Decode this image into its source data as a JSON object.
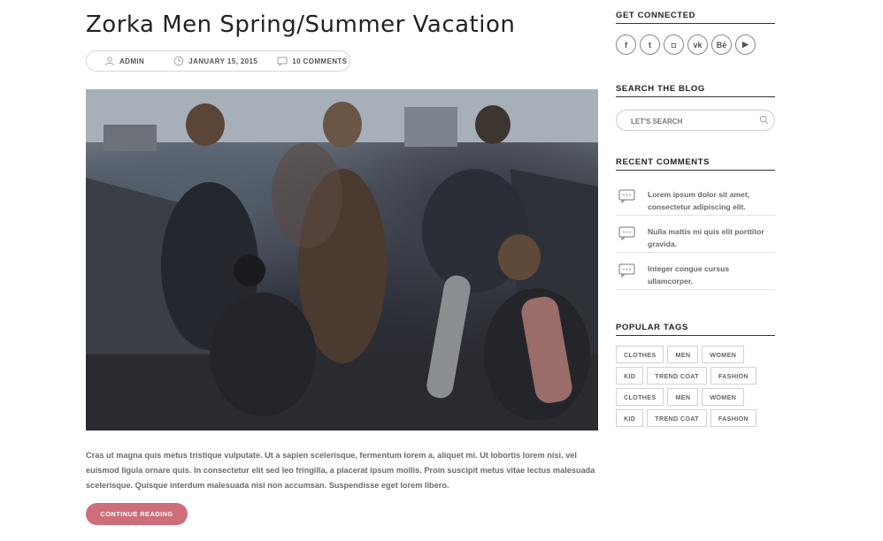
{
  "post": {
    "title": "Zorka Men Spring/Summer Vacation",
    "meta": {
      "author": "ADMIN",
      "date": "JANUARY 15, 2015",
      "comments": "10 COMMENTS"
    },
    "excerpt": "Cras ut magna quis metus tristique vulputate. Ut a sapien scelerisque, fermentum lorem a, aliquet mi. Ut lobortis lorem nisi, vel euismod ligula ornare quis. In consectetur elit sed leo fringilla, a placerat ipsum mollis. Proin suscipit metus vitae lectus malesuada scelerisque. Quisque interdum malesuada nisi non accumsan. Suspendisse eget lorem libero.",
    "continue_label": "CONTINUE READING",
    "image_icon": "photo-icon"
  },
  "sidebar": {
    "connected_title": "GET CONNECTED",
    "social": [
      {
        "icon": "facebook-icon",
        "glyph": "f"
      },
      {
        "icon": "twitter-icon",
        "glyph": "t"
      },
      {
        "icon": "instagram-icon",
        "glyph": "◘"
      },
      {
        "icon": "vk-icon",
        "glyph": "vk"
      },
      {
        "icon": "behance-icon",
        "glyph": "Bē"
      },
      {
        "icon": "youtube-icon",
        "glyph": "▶"
      }
    ],
    "search_title": "SEARCH THE BLOG",
    "search_placeholder": "LET'S SEARCH",
    "recent_title": "RECENT COMMENTS",
    "recent": [
      {
        "text": "Lorem ipsum dolor sit amet, consectetur adipiscing elit."
      },
      {
        "text": "Nulla mattis mi quis elit porttitor gravida."
      },
      {
        "text": "Integer congue cursus ullamcorper."
      }
    ],
    "tags_title": "POPULAR TAGS",
    "tags": [
      "CLOTHES",
      "MEN",
      "WOMEN",
      "KID",
      "TREND COAT",
      "FASHION",
      "CLOTHES",
      "MEN",
      "WOMEN",
      "KID",
      "TREND COAT",
      "FASHION"
    ]
  },
  "colors": {
    "accent": "#cd6e78",
    "text": "#333333",
    "muted": "#6b6b6b"
  }
}
